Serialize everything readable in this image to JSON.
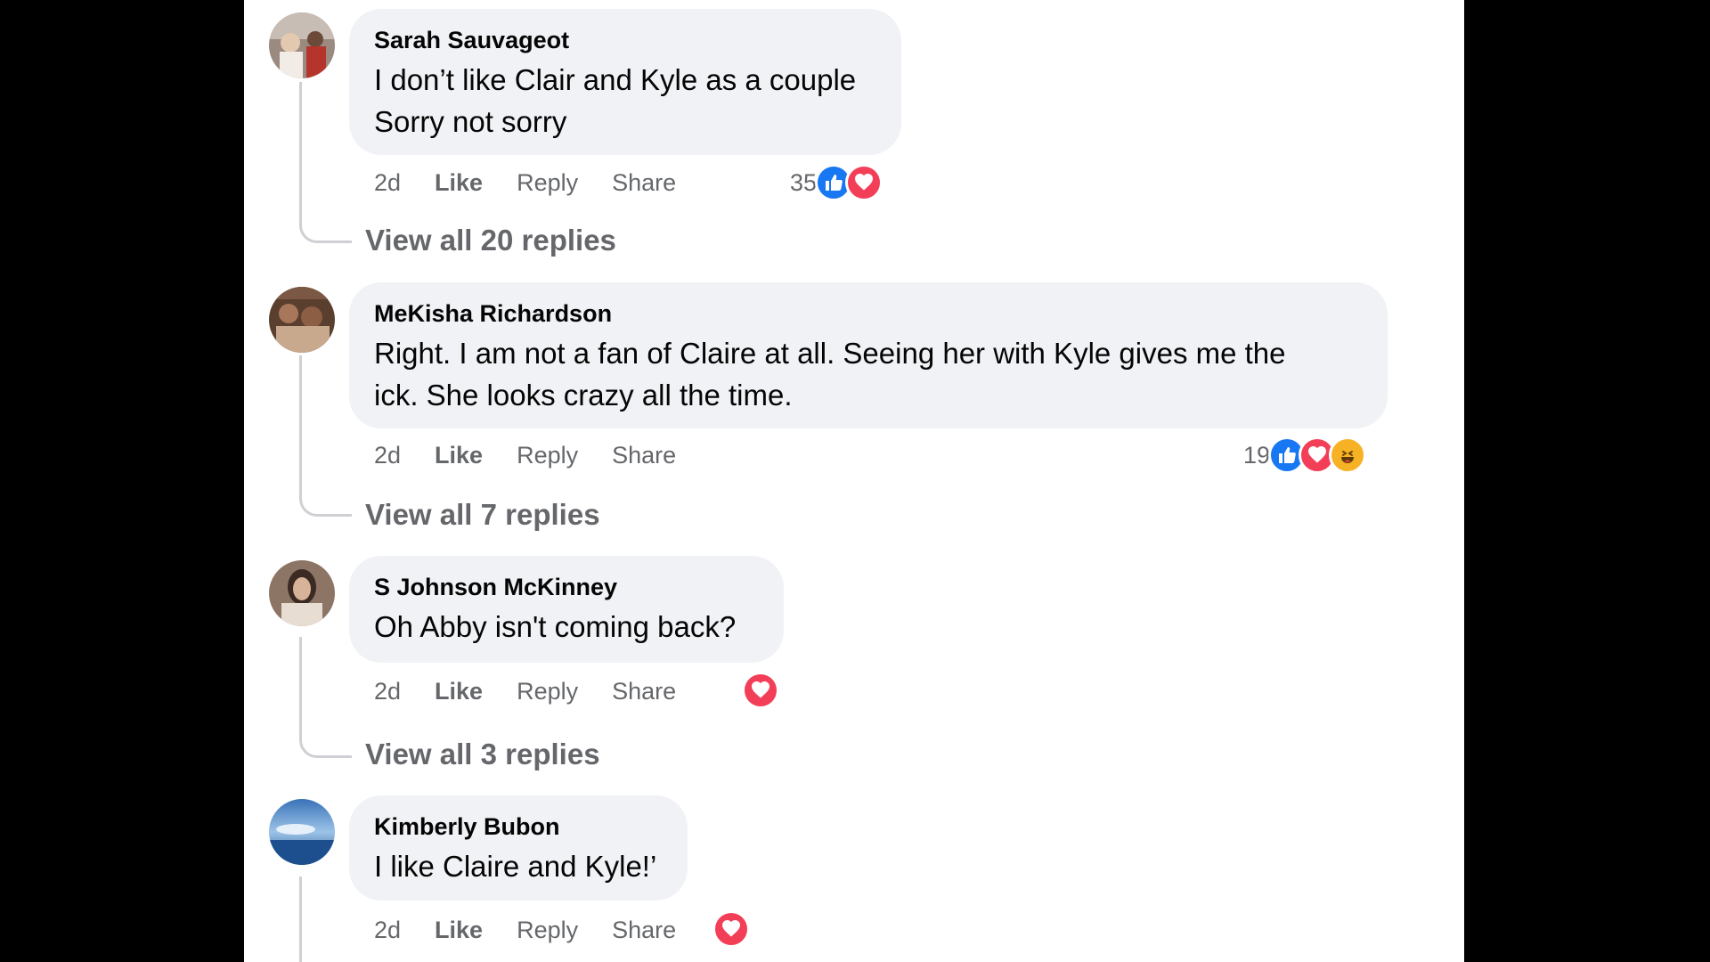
{
  "colors": {
    "like_blue": "#1877f2",
    "love_red": "#f33e58",
    "haha_yellow": "#f7b125",
    "bubble_bg": "#f0f2f5",
    "meta_gray": "#65676b"
  },
  "comments": [
    {
      "author": "Sarah Sauvageot",
      "line1": "I don’t like Clair and Kyle as a couple",
      "line2": "Sorry not sorry",
      "time": "2d",
      "like": "Like",
      "reply": "Reply",
      "share": "Share",
      "reaction_count": "35",
      "reactions": [
        "like-icon",
        "love-icon"
      ],
      "view_replies": "View all 20 replies"
    },
    {
      "author": "MeKisha Richardson",
      "line1": "Right. I am not a fan of Claire at all. Seeing her with Kyle gives me the",
      "line2": "ick. She looks crazy all the time.",
      "time": "2d",
      "like": "Like",
      "reply": "Reply",
      "share": "Share",
      "reaction_count": "19",
      "reactions": [
        "like-icon",
        "love-icon",
        "haha-icon"
      ],
      "view_replies": "View all 7 replies"
    },
    {
      "author": "S Johnson McKinney",
      "line1": "Oh Abby isn't coming back?",
      "time": "2d",
      "like": "Like",
      "reply": "Reply",
      "share": "Share",
      "reactions": [
        "love-icon"
      ],
      "view_replies": "View all 3 replies"
    },
    {
      "author": "Kimberly Bubon",
      "line1": "I like Claire and Kyle!’",
      "time": "2d",
      "like": "Like",
      "reply": "Reply",
      "share": "Share",
      "reactions": [
        "love-icon"
      ]
    }
  ]
}
